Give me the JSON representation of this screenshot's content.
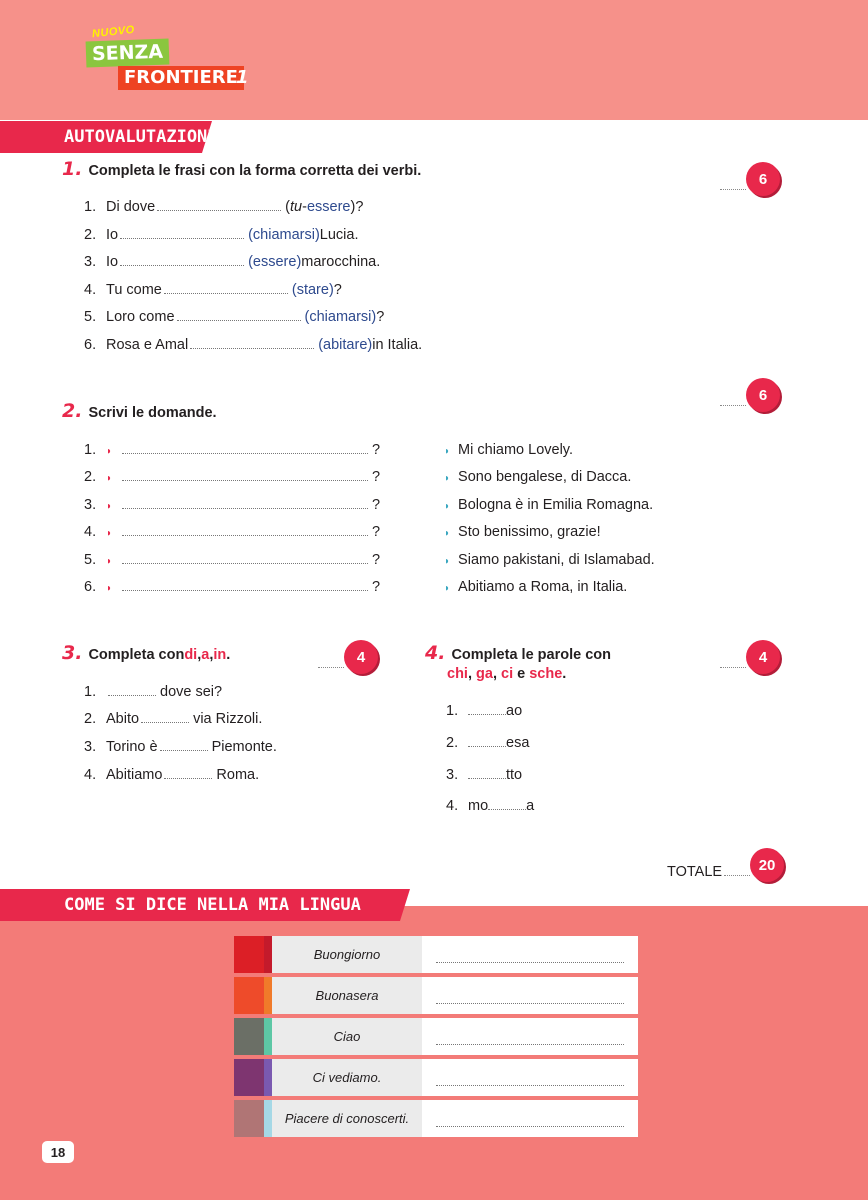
{
  "logo": {
    "nuovo": "NUOVO",
    "senza": "SENZA",
    "frontiere": "FRONTIERE",
    "volume": "1"
  },
  "section1": {
    "title": "AUTOVALUTAZIONE"
  },
  "ex1": {
    "num": "1.",
    "title": "Completa le frasi con la forma corretta dei verbi.",
    "score": "6",
    "items": [
      {
        "n": "1.",
        "pre": "Di dove",
        "hint_open": "(",
        "hint_italic": "tu",
        "hint_sep": " - ",
        "hint_verb": "essere",
        "hint_close": ")",
        "post": "?"
      },
      {
        "n": "2.",
        "pre": "Io",
        "hint": "(chiamarsi)",
        "post": " Lucia."
      },
      {
        "n": "3.",
        "pre": "Io",
        "hint": "(essere)",
        "post": " marocchina."
      },
      {
        "n": "4.",
        "pre": "Tu come",
        "hint": "(stare)",
        "post": "?"
      },
      {
        "n": "5.",
        "pre": "Loro come",
        "hint": "(chiamarsi)",
        "post": "?"
      },
      {
        "n": "6.",
        "pre": "Rosa e Amal",
        "hint": "(abitare)",
        "post": " in Italia."
      }
    ]
  },
  "ex2": {
    "num": "2.",
    "title": "Scrivi le domande.",
    "score": "6",
    "questions": [
      {
        "n": "1.",
        "end": "?"
      },
      {
        "n": "2.",
        "end": "?"
      },
      {
        "n": "3.",
        "end": "?"
      },
      {
        "n": "4.",
        "end": "?"
      },
      {
        "n": "5.",
        "end": "?"
      },
      {
        "n": "6.",
        "end": "?"
      }
    ],
    "answers": [
      "Mi chiamo Lovely.",
      "Sono bengalese, di Dacca.",
      "Bologna è in Emilia Romagna.",
      "Sto benissimo, grazie!",
      "Siamo pakistani, di Islamabad.",
      "Abitiamo a Roma, in Italia."
    ]
  },
  "ex3": {
    "num": "3.",
    "title_pre": "Completa con ",
    "w1": "di",
    "c1": ", ",
    "w2": "a",
    "c2": ", ",
    "w3": "in",
    "end": ".",
    "score": "4",
    "items": [
      {
        "n": "1.",
        "pre": "",
        "post": "dove sei?"
      },
      {
        "n": "2.",
        "pre": "Abito",
        "post": "via Rizzoli."
      },
      {
        "n": "3.",
        "pre": "Torino è",
        "post": "Piemonte."
      },
      {
        "n": "4.",
        "pre": "Abitiamo",
        "post": "Roma."
      }
    ]
  },
  "ex4": {
    "num": "4.",
    "title_line1": "Completa le parole con",
    "w1": "chi",
    "c1": ", ",
    "w2": "ga",
    "c2": ", ",
    "w3": "ci",
    "and": " e ",
    "w4": "sche",
    "end": ".",
    "score": "4",
    "items": [
      {
        "n": "1.",
        "pre": "",
        "post": "ao"
      },
      {
        "n": "2.",
        "pre": "",
        "post": "esa"
      },
      {
        "n": "3.",
        "pre": "",
        "post": "tto"
      },
      {
        "n": "4.",
        "pre": "mo",
        "post": "a"
      }
    ]
  },
  "totale": {
    "label": "TOTALE",
    "score": "20"
  },
  "section2": {
    "title": "COME SI DICE NELLA MIA LINGUA MATERNA?"
  },
  "phrases": [
    {
      "label": "Buongiorno",
      "color1": "#dc1f26",
      "color2": "#c41a2b"
    },
    {
      "label": "Buonasera",
      "color1": "#ee4b2a",
      "color2": "#f07a2a"
    },
    {
      "label": "Ciao",
      "color1": "#6b6f66",
      "color2": "#5dc7a5"
    },
    {
      "label": "Ci vediamo.",
      "color1": "#7e3570",
      "color2": "#7a59b0"
    },
    {
      "label": "Piacere di conoscerti.",
      "color1": "#b07575",
      "color2": "#a5d8e6"
    }
  ],
  "page": {
    "number": "18"
  }
}
